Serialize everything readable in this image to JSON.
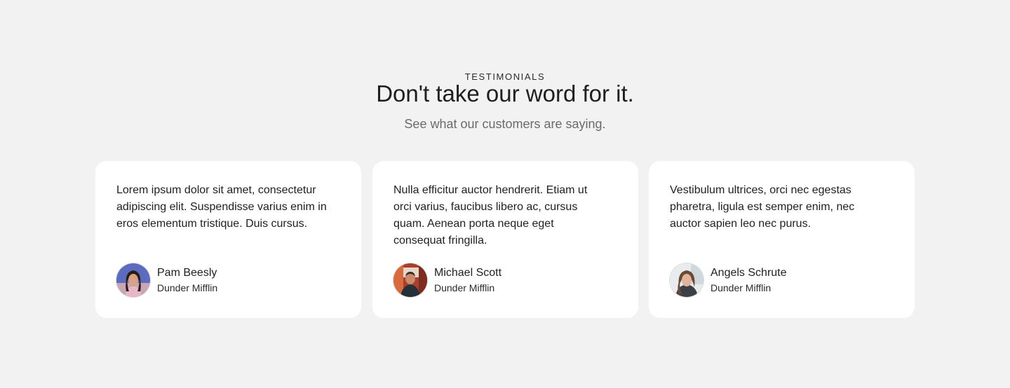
{
  "section": {
    "eyebrow": "TESTIMONIALS",
    "title": "Don't take our word for it.",
    "subtitle": "See what our customers are saying."
  },
  "testimonials": [
    {
      "quote": "Lorem ipsum dolor sit amet, consectetur adipiscing elit. Suspendisse varius enim in eros elementum tristique. Duis cursus.",
      "name": "Pam Beesly",
      "company": "Dunder Mifflin",
      "avatar_icon": "avatar-pam-beesly"
    },
    {
      "quote": "Nulla efficitur auctor hendrerit. Etiam ut orci varius, faucibus libero ac, cursus quam. Aenean porta neque eget consequat fringilla.",
      "name": "Michael Scott",
      "company": "Dunder Mifflin",
      "avatar_icon": "avatar-michael-scott"
    },
    {
      "quote": "Vestibulum ultrices, orci nec egestas pharetra, ligula est semper enim, nec auctor sapien leo nec purus.",
      "name": "Angels Schrute",
      "company": "Dunder Mifflin",
      "avatar_icon": "avatar-angels-schrute"
    }
  ],
  "colors": {
    "background": "#f2f2f2",
    "card": "#ffffff",
    "text": "#1f1f1f",
    "muted": "#6b6b6b"
  }
}
